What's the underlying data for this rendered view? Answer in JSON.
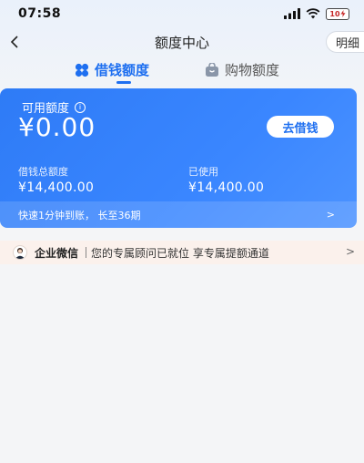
{
  "status_bar": {
    "time": "07:58",
    "battery": "10"
  },
  "nav": {
    "title": "额度中心",
    "detail_label": "明细"
  },
  "tabs": [
    {
      "label": "借钱额度",
      "active": true,
      "icon": "clover-icon"
    },
    {
      "label": "购物额度",
      "active": false,
      "icon": "shopping-bag-icon"
    }
  ],
  "card": {
    "available_label": "可用额度",
    "available_amount": "¥0.00",
    "borrow_button": "去借钱",
    "total_label": "借钱总额度",
    "total_value": "¥14,400.00",
    "used_label": "已使用",
    "used_value": "¥14,400.00",
    "footer_text": "快速1分钟到账， 长至36期",
    "footer_arrow": ">"
  },
  "wecom": {
    "title": "企业微信",
    "message": "您的专属顾问已就位 享专属提额通道",
    "arrow": ">"
  },
  "colors": {
    "accent": "#1e6ff0",
    "card_blue": "#3a86ff",
    "wecom_bg": "#fbf1ec"
  }
}
